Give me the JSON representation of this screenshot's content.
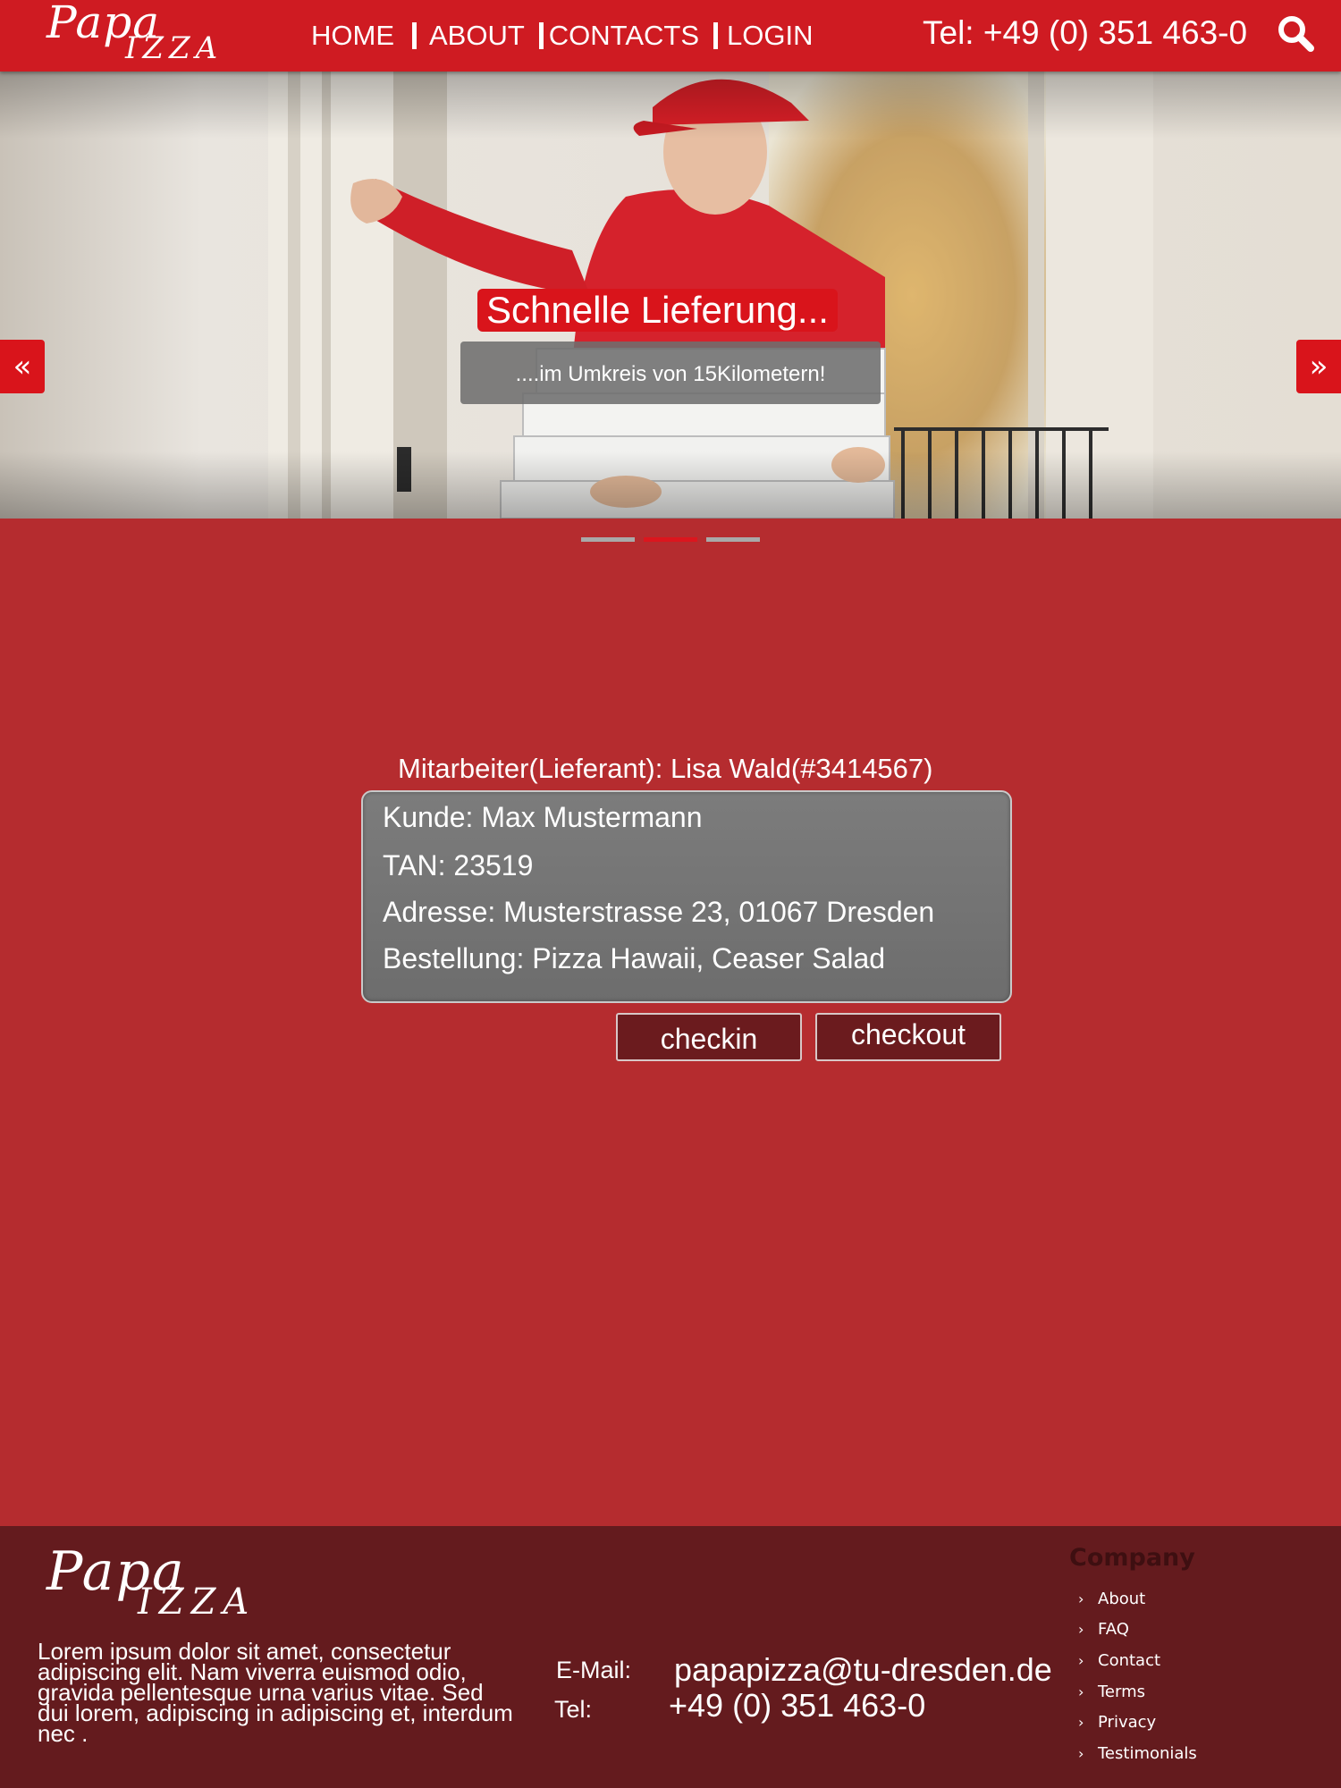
{
  "header": {
    "logo_top": "Papa",
    "logo_bottom": "IZZA",
    "nav": [
      "HOME",
      "ABOUT",
      "CONTACTS",
      "LOGIN"
    ],
    "phone": "Tel:  +49 (0) 351 463-0",
    "search_icon": "search-icon"
  },
  "slider": {
    "title": "Schnelle Lieferung...",
    "subtitle": "....im Umkreis von  15Kilometern!",
    "prev_icon": "double-chevron-left-icon",
    "next_icon": "double-chevron-right-icon",
    "slide_count": 3,
    "active_slide": 2
  },
  "order": {
    "employee": "Mitarbeiter(Lieferant): Lisa Wald(#3414567)",
    "customer": "Kunde: Max Mustermann",
    "tan": "TAN: 23519",
    "address": "Adresse: Musterstrasse 23, 01067 Dresden",
    "items": "Bestellung: Pizza Hawaii, Ceaser Salad",
    "checkin_label": "checkin",
    "checkout_label": "checkout"
  },
  "footer": {
    "logo_top": "Papa",
    "logo_bottom": "IZZA",
    "text": "Lorem ipsum dolor sit amet, consectetur adipiscing elit. Nam viverra euismod odio, gravida pellentesque urna varius vitae. Sed dui lorem, adipiscing in adipiscing et, interdum nec .",
    "email_label": "E-Mail:",
    "email": "papapizza@tu-dresden.de",
    "tel_label": "Tel:",
    "tel": "+49 (0) 351 463-0",
    "company_title": "Company",
    "company_links": [
      "About",
      "FAQ",
      "Contact",
      "Terms",
      "Privacy",
      "Testimonials"
    ]
  },
  "colors": {
    "header_red": "#cf1b22",
    "page_red": "#b52c2f",
    "footer_dark": "#641b1e",
    "accent_red": "#d9141b",
    "panel_gray": "#737373"
  }
}
